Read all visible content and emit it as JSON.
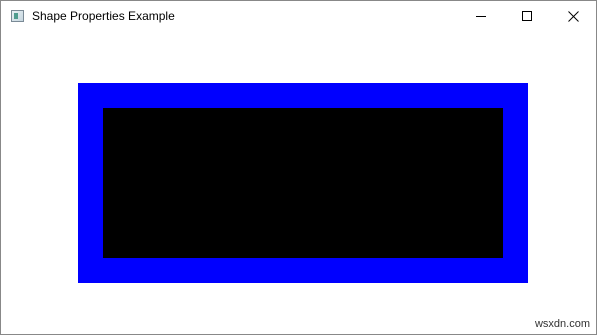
{
  "window": {
    "title": "Shape Properties Example",
    "icon": "java-app-icon",
    "controls": {
      "minimize": "minimize-icon",
      "maximize": "maximize-icon",
      "close": "close-icon"
    }
  },
  "shape": {
    "type": "rectangle",
    "fill_color": "#000000",
    "stroke_color": "#0000ff"
  },
  "watermark": {
    "text": "wsxdn.com"
  }
}
